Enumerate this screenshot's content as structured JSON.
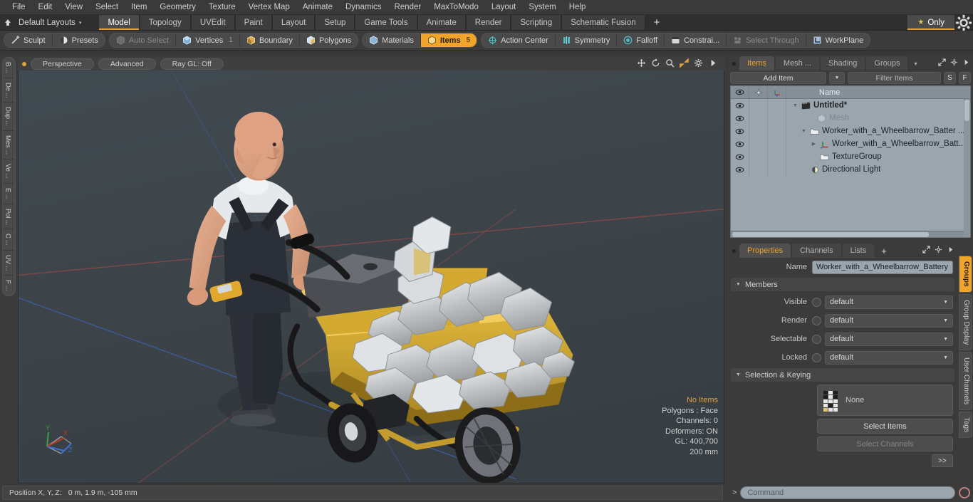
{
  "menubar": {
    "items": [
      "File",
      "Edit",
      "View",
      "Select",
      "Item",
      "Geometry",
      "Texture",
      "Vertex Map",
      "Animate",
      "Dynamics",
      "Render",
      "MaxToModo",
      "Layout",
      "System",
      "Help"
    ]
  },
  "layoutbar": {
    "layout_name": "Default Layouts",
    "caret": "▾",
    "tabs": [
      "Model",
      "Topology",
      "UVEdit",
      "Paint",
      "Layout",
      "Setup",
      "Game Tools",
      "Animate",
      "Render",
      "Scripting",
      "Schematic Fusion"
    ],
    "active_tab": "Model",
    "add_tab": "+",
    "only_label": "Only",
    "star": "★"
  },
  "modebar": {
    "group1": [
      {
        "label": "Sculpt",
        "icon": "sculpt-icon",
        "state": "normal",
        "count": ""
      },
      {
        "label": "Presets",
        "icon": "presets-icon",
        "state": "normal",
        "count": ""
      }
    ],
    "group2": [
      {
        "label": "Auto Select",
        "icon": "auto-select-icon",
        "state": "dim",
        "count": ""
      },
      {
        "label": "Vertices",
        "icon": "vertices-icon",
        "state": "normal",
        "count": "1"
      },
      {
        "label": "Boundary",
        "icon": "boundary-icon",
        "state": "normal",
        "count": ""
      },
      {
        "label": "Polygons",
        "icon": "polygons-icon",
        "state": "normal",
        "count": ""
      }
    ],
    "group3": [
      {
        "label": "Materials",
        "icon": "materials-icon",
        "state": "normal",
        "count": ""
      },
      {
        "label": "Items",
        "icon": "items-icon",
        "state": "selected",
        "count": "5"
      }
    ],
    "group4": [
      {
        "label": "Action Center",
        "icon": "action-center-icon",
        "state": "normal",
        "count": ""
      },
      {
        "label": "Symmetry",
        "icon": "symmetry-icon",
        "state": "normal",
        "count": ""
      },
      {
        "label": "Falloff",
        "icon": "falloff-icon",
        "state": "normal",
        "count": ""
      },
      {
        "label": "Constrai...",
        "icon": "constraint-icon",
        "state": "normal",
        "count": ""
      },
      {
        "label": "Select Through",
        "icon": "select-through-icon",
        "state": "dim",
        "count": ""
      },
      {
        "label": "WorkPlane",
        "icon": "workplane-icon",
        "state": "normal",
        "count": ""
      }
    ]
  },
  "left_tabs": [
    "B ...",
    "De ...",
    "Dup ...",
    "Mes ...",
    "Ve ...",
    "E ...",
    "Pol ...",
    "C ...",
    "UV ...",
    "F ..."
  ],
  "viewport": {
    "pills": [
      "Perspective",
      "Advanced",
      "Ray GL: Off"
    ],
    "icons": [
      "pan-icon",
      "rotate-icon",
      "zoom-icon",
      "fit-icon",
      "gear-icon",
      "chevron-right-icon"
    ],
    "stats": {
      "selection": "No Items",
      "polygons": "Polygons : Face",
      "channels": "Channels: 0",
      "deformers": "Deformers: ON",
      "gl": "GL: 400,700",
      "scale": "200 mm"
    },
    "gizmo_axes": [
      "Y",
      "X",
      "Z"
    ]
  },
  "statusbar": {
    "label": "Position X, Y, Z:",
    "value": "0 m, 1.9 m, -105 mm"
  },
  "items_panel": {
    "tabs": [
      "Items",
      "Mesh ...",
      "Shading",
      "Groups"
    ],
    "active_tab": "Items",
    "caret": "▾",
    "add_item": "Add Item",
    "dropdown_caret": "▼",
    "filter_placeholder": "Filter Items",
    "btn_s": "S",
    "btn_f": "F",
    "columns": {
      "eye": "eye-icon",
      "draw": "draw-icon",
      "axis": "axis-icon",
      "name": "Name"
    },
    "rows": [
      {
        "name": "Untitled*",
        "icon": "scene-icon",
        "depth": 0,
        "bold": true,
        "dim": false,
        "twirl": "▼"
      },
      {
        "name": "Mesh",
        "icon": "mesh-icon",
        "depth": 1,
        "bold": false,
        "dim": true,
        "twirl": ""
      },
      {
        "name": "Worker_with_a_Wheelbarrow_Batter ...",
        "icon": "group-icon",
        "depth": 1,
        "bold": false,
        "dim": false,
        "twirl": "▼"
      },
      {
        "name": "Worker_with_a_Wheelbarrow_Batt...",
        "icon": "locator-icon",
        "depth": 2,
        "bold": false,
        "dim": false,
        "twirl": "▶"
      },
      {
        "name": "TextureGroup",
        "icon": "group-icon",
        "depth": 2,
        "bold": false,
        "dim": false,
        "twirl": ""
      },
      {
        "name": "Directional Light",
        "icon": "light-icon",
        "depth": 1,
        "bold": false,
        "dim": false,
        "twirl": ""
      }
    ]
  },
  "properties_panel": {
    "tabs": [
      "Properties",
      "Channels",
      "Lists"
    ],
    "active_tab": "Properties",
    "add_tab": "+",
    "name_label": "Name",
    "name_value": "Worker_with_a_Wheelbarrow_Battery",
    "members_section": "Members",
    "fields": [
      {
        "label": "Visible",
        "value": "default"
      },
      {
        "label": "Render",
        "value": "default"
      },
      {
        "label": "Selectable",
        "value": "default"
      },
      {
        "label": "Locked",
        "value": "default"
      }
    ],
    "selection_section": "Selection & Keying",
    "selection_value": "None",
    "select_items_button": "Select Items",
    "select_channels_button": "Select Channels",
    "expand_button": ">>"
  },
  "right_tabs": [
    {
      "label": "Groups",
      "active": true
    },
    {
      "label": "Group Display",
      "active": false
    },
    {
      "label": "User Channels",
      "active": false
    },
    {
      "label": "Tags",
      "active": false
    }
  ],
  "command_bar": {
    "prompt": ">",
    "placeholder": "Command",
    "record_icon": "record-icon"
  },
  "colors": {
    "accent": "#f0a42a",
    "panel": "#3b3b3b",
    "tree_bg": "#9aa5ad",
    "viewport_bg": "#3c4449",
    "axis_x": "#c0392b",
    "axis_z": "#2f6fd0"
  }
}
